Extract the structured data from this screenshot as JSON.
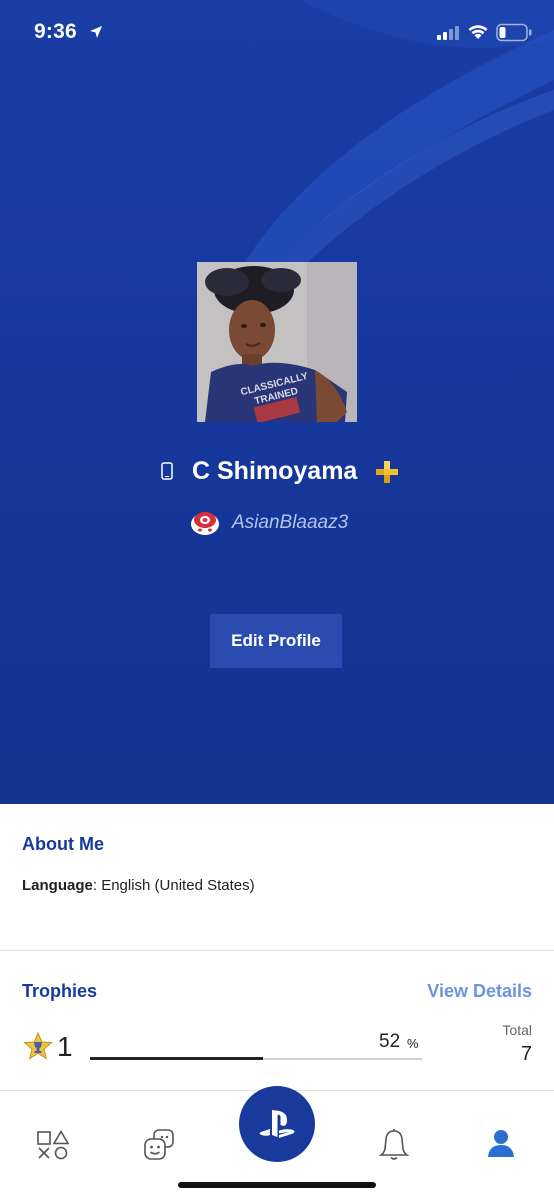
{
  "status_bar": {
    "time": "9:36",
    "icons": [
      "location-arrow-icon",
      "cellular-signal-icon",
      "wifi-icon",
      "battery-icon"
    ]
  },
  "profile": {
    "display_name": "C Shimoyama",
    "online_id": "AsianBlaaaz3",
    "platform_icon": "mobile-phone-icon",
    "membership_icon": "playstation-plus-icon",
    "avatar_shirt_text": [
      "CLASSICALLY",
      "TRAINED"
    ],
    "edit_button_label": "Edit Profile"
  },
  "about": {
    "title": "About Me",
    "language_label": "Language",
    "language_separator": ": ",
    "language_value": "English (United States)"
  },
  "trophies": {
    "title": "Trophies",
    "view_details_label": "View Details",
    "level": "1",
    "progress_percent": "52",
    "progress_fraction": 0.52,
    "percent_sign": "%",
    "total_label": "Total",
    "total_value": "7"
  },
  "tabbar": {
    "items": [
      "games-icon",
      "friends-icon",
      "playstation-home-icon",
      "notifications-bell-icon",
      "profile-icon"
    ],
    "active": "profile-icon"
  },
  "colors": {
    "hero_blue": "#16389e",
    "title_blue": "#173a9c",
    "link_blue": "#6b95de",
    "button_blue": "#2a4cb0",
    "plus_gold": "#f1c232",
    "active_tab": "#2a6fcf"
  }
}
